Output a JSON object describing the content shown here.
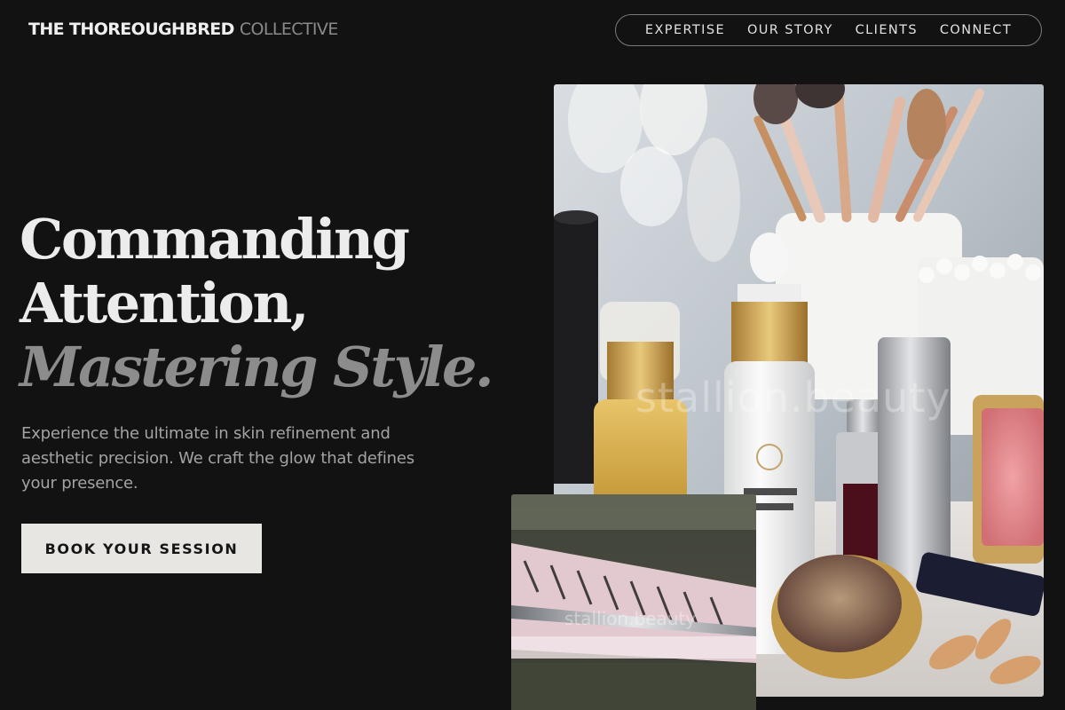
{
  "brand": {
    "name_primary": "THE THOREOUGHBRED",
    "name_secondary": "COLLECTIVE"
  },
  "nav": {
    "items": [
      {
        "label": "EXPERTISE"
      },
      {
        "label": "OUR STORY"
      },
      {
        "label": "CLIENTS"
      },
      {
        "label": "CONNECT"
      }
    ]
  },
  "hero": {
    "headline_line1": "Commanding",
    "headline_line2": "Attention,",
    "headline_line3": "Mastering Style.",
    "subtext": "Experience the ultimate in skin refinement and aesthetic precision. We craft the glow that defines your presence.",
    "cta_label": "BOOK YOUR SESSION"
  },
  "images": {
    "main_watermark": "stallion.beauty",
    "secondary_watermark": "stallion.beauty"
  },
  "colors": {
    "background": "#121212",
    "text_primary": "#ececec",
    "text_muted": "#8c8c8c",
    "cta_background": "#e8e6e3"
  }
}
